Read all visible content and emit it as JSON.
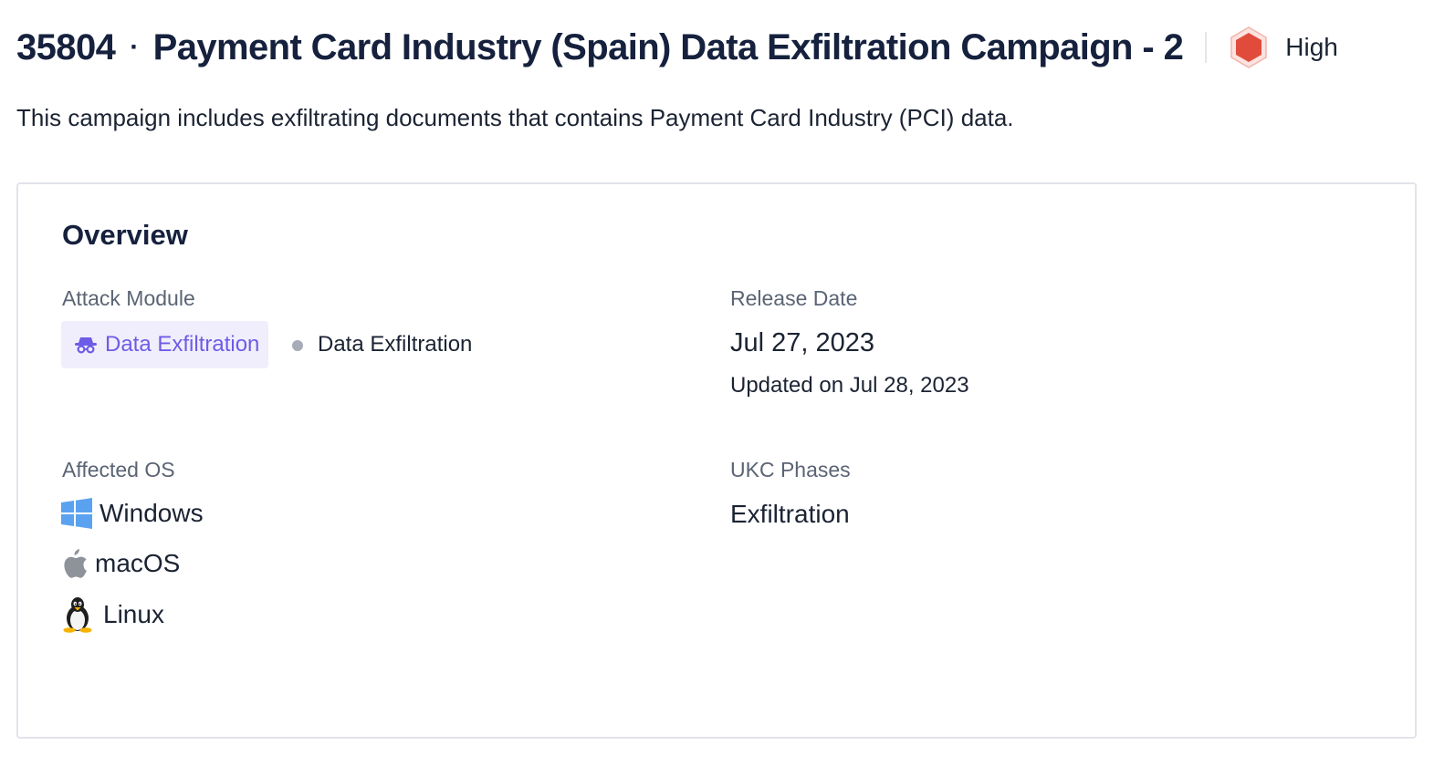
{
  "header": {
    "id": "35804",
    "separator": "·",
    "title": "Payment Card Industry (Spain) Data Exfiltration Campaign - 2",
    "severity": {
      "label": "High",
      "icon": "hexagon-severity-icon",
      "color": "#e14b3b"
    }
  },
  "description": "This campaign includes exfiltrating documents that contains Payment Card Industry (PCI) data.",
  "overview": {
    "title": "Overview",
    "attack_module": {
      "label": "Attack Module",
      "tag": {
        "text": "Data Exfiltration",
        "icon": "spy-icon",
        "color": "#6d5ce6"
      },
      "sub": "Data Exfiltration"
    },
    "release_date": {
      "label": "Release Date",
      "date": "Jul 27, 2023",
      "updated": "Updated on Jul 28, 2023"
    },
    "affected_os": {
      "label": "Affected OS",
      "items": [
        {
          "name": "Windows",
          "icon": "windows-icon"
        },
        {
          "name": "macOS",
          "icon": "apple-icon"
        },
        {
          "name": "Linux",
          "icon": "linux-penguin-icon"
        }
      ]
    },
    "ukc_phases": {
      "label": "UKC Phases",
      "items": [
        "Exfiltration"
      ]
    }
  }
}
